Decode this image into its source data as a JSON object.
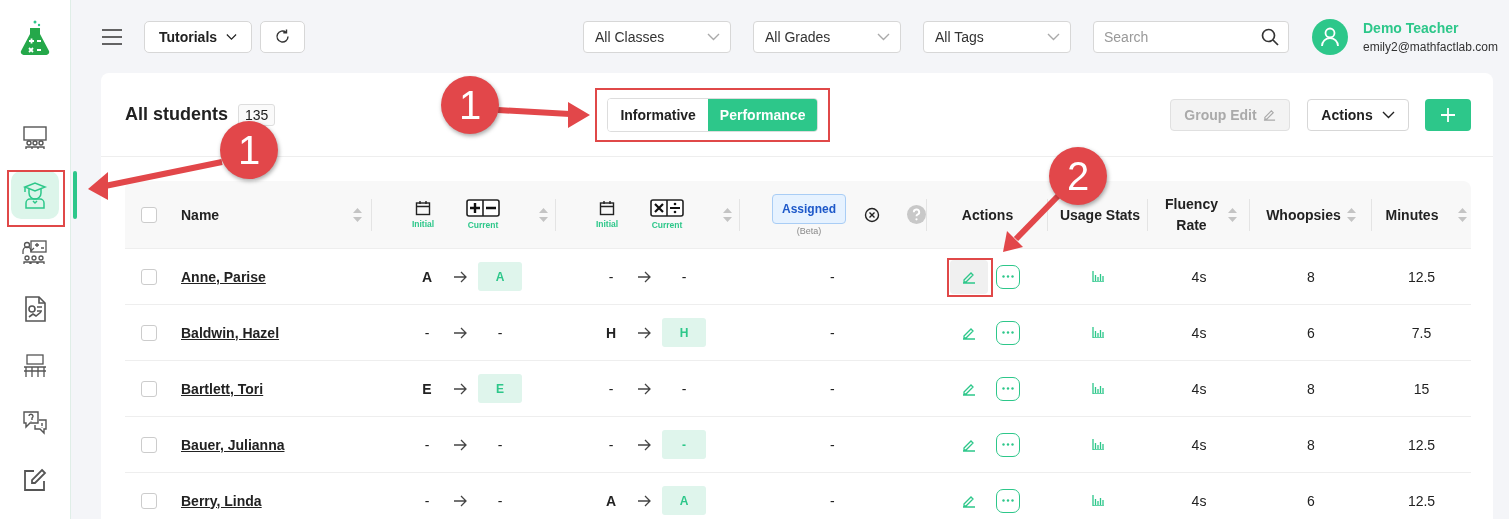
{
  "sidebar": {
    "items": [
      {
        "kind": "classroom",
        "selected": false
      },
      {
        "kind": "students",
        "selected": true
      },
      {
        "kind": "lessons",
        "selected": false
      },
      {
        "kind": "reports",
        "selected": false
      },
      {
        "kind": "desks",
        "selected": false
      },
      {
        "kind": "help",
        "selected": false
      },
      {
        "kind": "notes",
        "selected": false
      }
    ]
  },
  "top_bar": {
    "tutorials": "Tutorials",
    "filters": [
      "All Classes",
      "All Grades",
      "All Tags"
    ],
    "search": {
      "placeholder": "Search"
    },
    "user": {
      "name": "Demo Teacher",
      "email": "emily2@mathfactlab.com"
    }
  },
  "panel": {
    "title": "All students",
    "count": "135",
    "view_toggle": [
      {
        "label": "Informative",
        "selected": false
      },
      {
        "label": "Performance",
        "selected": true
      }
    ],
    "group_edit": {
      "label": "Group Edit",
      "disabled": true
    },
    "actions": "Actions"
  },
  "table": {
    "all_checked": false,
    "columns": {
      "name": "Name",
      "addition": {
        "initial": "Initial",
        "current": "Current"
      },
      "multiplication": {
        "initial": "Initial",
        "current": "Current"
      },
      "assigned": {
        "label": "Assigned",
        "note": "(Beta)"
      },
      "actions": "Actions",
      "usage": "Usage Stats",
      "fluency": "Fluency Rate",
      "whoopsies": "Whoopsies",
      "minutes": "Minutes"
    },
    "rows": [
      {
        "checked": false,
        "name": "Anne, Parise",
        "addition": {
          "initial": "A",
          "current": "A",
          "highlighted": true
        },
        "multiplication": {
          "initial": "-",
          "current": "-",
          "highlighted": false
        },
        "assigned": "-",
        "edit_active": true,
        "fluency": "4s",
        "whoopsies": "8",
        "minutes": "12.5"
      },
      {
        "checked": false,
        "name": "Baldwin, Hazel",
        "addition": {
          "initial": "-",
          "current": "-",
          "highlighted": false
        },
        "multiplication": {
          "initial": "H",
          "current": "H",
          "highlighted": true
        },
        "assigned": "-",
        "edit_active": false,
        "fluency": "4s",
        "whoopsies": "6",
        "minutes": "7.5"
      },
      {
        "checked": false,
        "name": "Bartlett, Tori",
        "addition": {
          "initial": "E",
          "current": "E",
          "highlighted": true
        },
        "multiplication": {
          "initial": "-",
          "current": "-",
          "highlighted": false
        },
        "assigned": "-",
        "edit_active": false,
        "fluency": "4s",
        "whoopsies": "8",
        "minutes": "15"
      },
      {
        "checked": false,
        "name": "Bauer, Julianna",
        "addition": {
          "initial": "-",
          "current": "-",
          "highlighted": false
        },
        "multiplication": {
          "initial": "-",
          "current": "-",
          "highlighted": true
        },
        "assigned": "-",
        "edit_active": false,
        "fluency": "4s",
        "whoopsies": "8",
        "minutes": "12.5"
      },
      {
        "checked": false,
        "name": "Berry, Linda",
        "addition": {
          "initial": "-",
          "current": "-",
          "highlighted": false
        },
        "multiplication": {
          "initial": "A",
          "current": "A",
          "highlighted": true
        },
        "assigned": "-",
        "edit_active": false,
        "fluency": "4s",
        "whoopsies": "6",
        "minutes": "12.5"
      }
    ]
  },
  "callouts": [
    {
      "number": "1"
    },
    {
      "number": "1"
    },
    {
      "number": "2"
    }
  ]
}
